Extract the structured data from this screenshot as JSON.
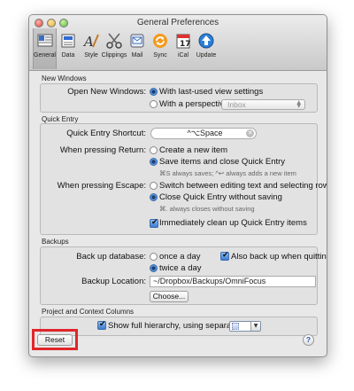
{
  "window": {
    "title": "General Preferences"
  },
  "toolbar": [
    {
      "label": "General",
      "icon": "general-pref-icon",
      "selected": true
    },
    {
      "label": "Data",
      "icon": "data-pref-icon",
      "selected": false
    },
    {
      "label": "Style",
      "icon": "style-pref-icon",
      "selected": false
    },
    {
      "label": "Clippings",
      "icon": "clippings-pref-icon",
      "selected": false
    },
    {
      "label": "Mail",
      "icon": "mail-pref-icon",
      "selected": false
    },
    {
      "label": "Sync",
      "icon": "sync-pref-icon",
      "selected": false
    },
    {
      "label": "iCal",
      "icon": "ical-pref-icon",
      "selected": false
    },
    {
      "label": "Update",
      "icon": "update-pref-icon",
      "selected": false
    }
  ],
  "new_windows": {
    "group_label": "New Windows",
    "open_label": "Open New Windows:",
    "option_last_used": "With last-used view settings",
    "option_perspective": "With a perspective:",
    "perspective_value": "Inbox",
    "selected": "last_used"
  },
  "quick_entry": {
    "group_label": "Quick Entry",
    "shortcut_label": "Quick Entry Shortcut:",
    "shortcut_value": "^⌥Space",
    "return_label": "When pressing Return:",
    "return_create": "Create a new item",
    "return_save": "Save items and close Quick Entry",
    "return_hint": "⌘S always saves; ^↩ always adds a new item",
    "escape_label": "When pressing Escape:",
    "escape_switch": "Switch between editing text and selecting row",
    "escape_close": "Close Quick Entry without saving",
    "escape_hint": "⌘. always closes without saving",
    "cleanup_label": "Immediately clean up Quick Entry items",
    "cleanup_checked": true
  },
  "backups": {
    "group_label": "Backups",
    "backup_label": "Back up database:",
    "once_day": "once a day",
    "twice_day": "twice a day",
    "selected": "twice",
    "also_quit": "Also back up when quitting",
    "also_quit_checked": true,
    "location_label": "Backup Location:",
    "location_value": "~/Dropbox/Backups/OmniFocus",
    "choose_button": "Choose..."
  },
  "columns": {
    "group_label": "Project and Context Columns",
    "hierarchy_label": "Show full hierarchy, using separator:",
    "hierarchy_checked": true,
    "separator_value": ":"
  },
  "footer": {
    "reset_button": "Reset",
    "help_glyph": "?"
  },
  "colors": {
    "highlight": "#e0262b",
    "selection": "#3d7cd3"
  }
}
